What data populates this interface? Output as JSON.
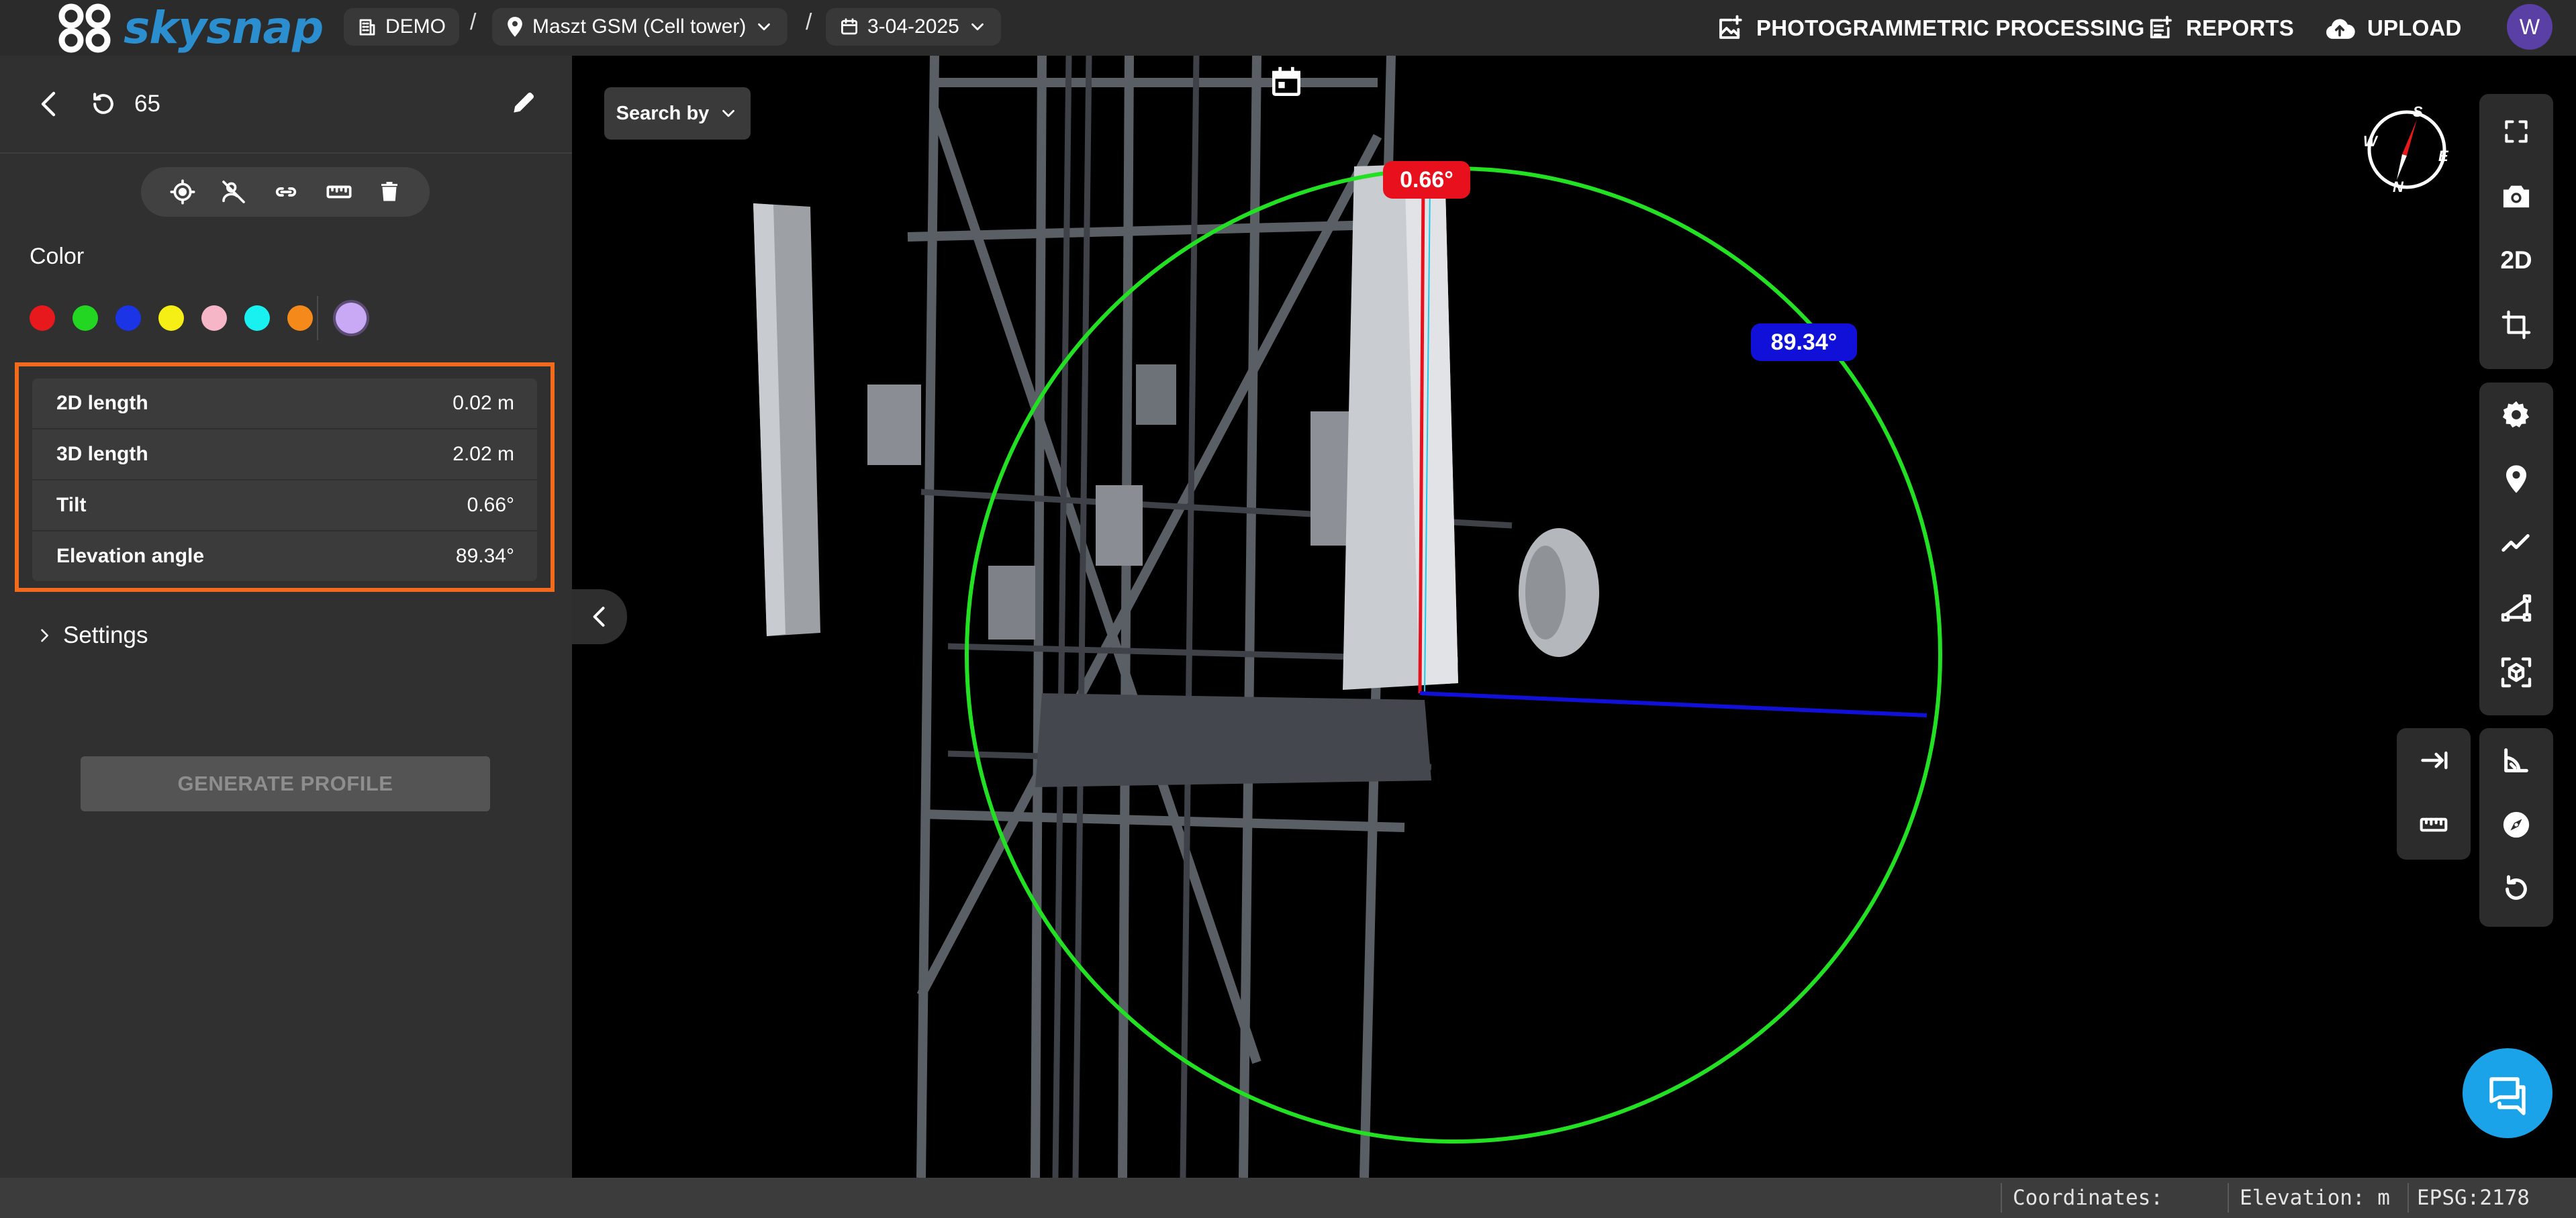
{
  "header": {
    "logo_text": "skysnap",
    "breadcrumb": {
      "project": "DEMO",
      "site": "Maszt GSM (Cell tower)",
      "date": "3-04-2025",
      "separator": "/"
    },
    "actions": {
      "processing": "PHOTOGRAMMETRIC PROCESSING",
      "reports": "REPORTS",
      "upload": "UPLOAD"
    },
    "avatar_initial": "W"
  },
  "panel": {
    "item_count": "65",
    "tools": [
      "target-icon",
      "hide-icon",
      "link-icon",
      "ruler-icon",
      "delete-icon"
    ],
    "color_label": "Color",
    "colors": [
      "#e8191c",
      "#22d622",
      "#1a34e6",
      "#f5ef15",
      "#f7b6c8",
      "#19f0f0",
      "#f58a1a"
    ],
    "selected_color": "#c9a9f5",
    "measurements": [
      {
        "label": "2D length",
        "value": "0.02 m"
      },
      {
        "label": "3D length",
        "value": "2.02 m"
      },
      {
        "label": "Tilt",
        "value": "0.66°"
      },
      {
        "label": "Elevation angle",
        "value": "89.34°"
      }
    ],
    "settings_label": "Settings",
    "generate_label": "GENERATE PROFILE"
  },
  "viewport": {
    "search_label": "Search by",
    "tilt_annotation": "0.66°",
    "elevation_annotation": "89.34°",
    "tilt_color": "#e8101c",
    "elevation_color": "#1010d8",
    "circle_color": "#22e022",
    "compass_labels": [
      "S",
      "E",
      "N",
      "W"
    ],
    "right_toolbar_top": [
      "fullscreen-icon",
      "camera-icon",
      "2D",
      "crop-icon"
    ],
    "right_toolbar_mid": [
      "settings-icon",
      "location-pin-icon",
      "polyline-icon",
      "polygon-icon",
      "cube-scan-icon"
    ],
    "right_toolbar_bottom": [
      "angle-icon",
      "compass-icon",
      "rotate-icon"
    ],
    "side_tools": [
      "arrow-right-bar-icon",
      "ruler-icon"
    ]
  },
  "status": {
    "coordinates": "Coordinates:",
    "elevation": "Elevation: m",
    "epsg": "EPSG:2178"
  }
}
